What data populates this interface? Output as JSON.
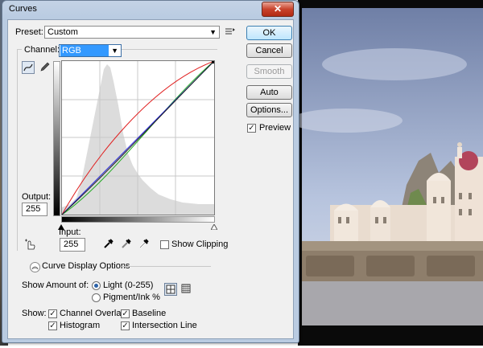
{
  "window": {
    "title": "Curves",
    "close_glyph": "✕"
  },
  "preset": {
    "label": "Preset:",
    "value": "Custom"
  },
  "channel": {
    "label": "Channel:",
    "value": "RGB"
  },
  "buttons": {
    "ok": "OK",
    "cancel": "Cancel",
    "smooth": "Smooth",
    "auto": "Auto",
    "options": "Options..."
  },
  "preview": {
    "label": "Preview",
    "checked": true
  },
  "output": {
    "label": "Output:",
    "value": "255"
  },
  "input": {
    "label": "Input:",
    "value": "255"
  },
  "show_clipping": {
    "label": "Show Clipping",
    "checked": false
  },
  "curve_display_options": {
    "label": "Curve Display Options"
  },
  "show_amount": {
    "label": "Show Amount of:",
    "light_label": "Light  (0-255)",
    "pigment_label": "Pigment/Ink %",
    "selected": "light"
  },
  "show": {
    "label": "Show:",
    "channel_overlays": "Channel Overlays",
    "histogram": "Histogram",
    "baseline": "Baseline",
    "intersection_line": "Intersection Line"
  },
  "curve_colors": {
    "rgb": "#222222",
    "red": "#e02020",
    "green": "#22aa22",
    "blue": "#2222dd"
  },
  "icons": {
    "preset_menu": "preset-options-icon",
    "curve_tool": "curve-point-icon",
    "pencil_tool": "pencil-icon",
    "target_adjust": "hand-adjust-icon",
    "black_eyedropper": "eyedropper-black-icon",
    "gray_eyedropper": "eyedropper-gray-icon",
    "white_eyedropper": "eyedropper-white-icon",
    "grid_simple": "grid-4-icon",
    "grid_detailed": "grid-10-icon"
  }
}
